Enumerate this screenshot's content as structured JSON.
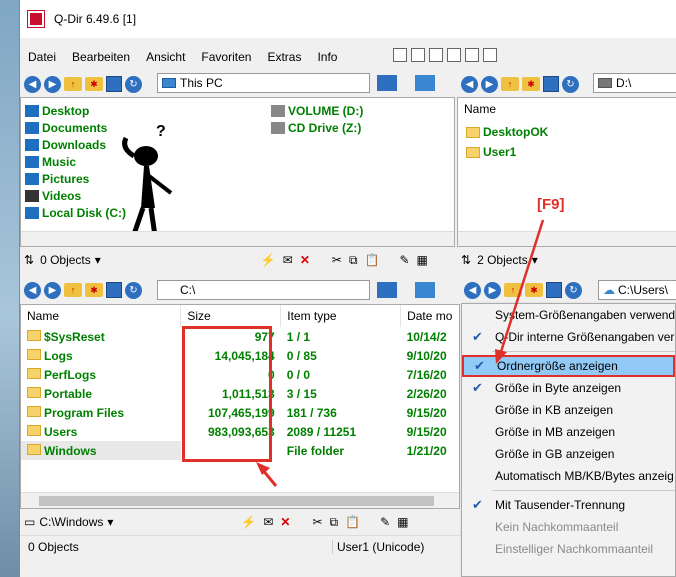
{
  "window": {
    "title": "Q-Dir 6.49.6 [1]"
  },
  "menu": [
    "Datei",
    "Bearbeiten",
    "Ansicht",
    "Favoriten",
    "Extras",
    "Info"
  ],
  "pane1": {
    "address": "This PC",
    "items_left": [
      {
        "label": "Desktop",
        "icon": "desktop-icon"
      },
      {
        "label": "Documents",
        "icon": "documents-icon"
      },
      {
        "label": "Downloads",
        "icon": "downloads-icon"
      },
      {
        "label": "Music",
        "icon": "music-icon"
      },
      {
        "label": "Pictures",
        "icon": "pictures-icon"
      },
      {
        "label": "Videos",
        "icon": "videos-icon"
      },
      {
        "label": "Local Disk (C:)",
        "icon": "drive-icon"
      }
    ],
    "items_right": [
      {
        "label": "VOLUME (D:)",
        "icon": "drive-icon"
      },
      {
        "label": "CD Drive (Z:)",
        "icon": "cd-drive-icon"
      }
    ],
    "status": "0 Objects"
  },
  "pane2": {
    "address": "D:\\",
    "column": "Name",
    "items": [
      "DesktopOK",
      "User1"
    ],
    "status": "2 Objects"
  },
  "pane3": {
    "address": "C:\\",
    "columns": [
      "Name",
      "Size",
      "Item type",
      "Date mo"
    ],
    "rows": [
      {
        "name": "$SysReset",
        "size": "977",
        "type": "1 / 1",
        "date": "10/14/2"
      },
      {
        "name": "Logs",
        "size": "14,045,184",
        "type": "0 / 85",
        "date": "9/10/20"
      },
      {
        "name": "PerfLogs",
        "size": "0",
        "type": "0 / 0",
        "date": "7/16/20"
      },
      {
        "name": "Portable",
        "size": "1,011,513",
        "type": "3 / 15",
        "date": "2/26/20"
      },
      {
        "name": "Program Files",
        "size": "107,465,199",
        "type": "181 / 736",
        "date": "9/15/20"
      },
      {
        "name": "Users",
        "size": "983,093,653",
        "type": "2089 / 11251",
        "date": "9/15/20"
      },
      {
        "name": "Windows",
        "size": "",
        "type": "File folder",
        "date": "1/21/20"
      }
    ],
    "footer_address": "C:\\Windows",
    "status_left": "0 Objects",
    "status_right": "User1 (Unicode)"
  },
  "pane4": {
    "address": "C:\\Users\\"
  },
  "annotation": {
    "key": "[F9]"
  },
  "context_menu": [
    {
      "label": "System-Größenangaben verwend",
      "checked": false,
      "disabled": false
    },
    {
      "label": "Q-Dir interne Größenangaben ver",
      "checked": true,
      "disabled": false
    },
    {
      "label": "Ordnergröße anzeigen",
      "checked": true,
      "disabled": false,
      "highlight": true
    },
    {
      "label": "Größe in Byte anzeigen",
      "checked": true,
      "disabled": false
    },
    {
      "label": "Größe in KB anzeigen",
      "checked": false,
      "disabled": false
    },
    {
      "label": "Größe in MB anzeigen",
      "checked": false,
      "disabled": false
    },
    {
      "label": "Größe in GB anzeigen",
      "checked": false,
      "disabled": false
    },
    {
      "label": "Automatisch MB/KB/Bytes anzeig",
      "checked": false,
      "disabled": false
    },
    {
      "label": "Mit Tausender-Trennung",
      "checked": true,
      "disabled": false
    },
    {
      "label": "Kein Nachkommaanteil",
      "checked": false,
      "disabled": true
    },
    {
      "label": "Einstelliger Nachkommaanteil",
      "checked": false,
      "disabled": true
    }
  ],
  "colors": {
    "accent_red": "#e0302a",
    "item_green": "#008000",
    "highlight": "#91c9f7"
  }
}
